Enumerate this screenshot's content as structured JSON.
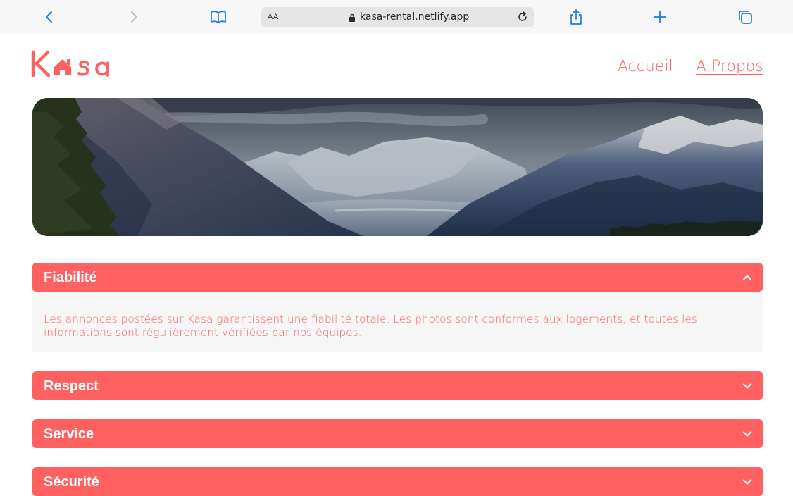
{
  "browser": {
    "reader_label": "AA",
    "url": "kasa-rental.netlify.app",
    "icons": [
      "back-icon",
      "forward-icon",
      "bookmarks-icon",
      "lock-icon",
      "reload-icon",
      "share-icon",
      "new-tab-icon",
      "tabs-icon"
    ]
  },
  "header": {
    "logo_text": "Kasa",
    "nav": [
      {
        "label": "Accueil"
      },
      {
        "label": "A Propos"
      }
    ]
  },
  "colors": {
    "accent": "#ff6060",
    "panel_bg": "#f6f6f6",
    "toolbar_bg": "#f7f7f7",
    "browser_blue": "#1f7ae0"
  },
  "collapses": [
    {
      "title": "Fiabilité",
      "expanded": true,
      "text": "Les annonces postées sur Kasa garantissent une fiabilité totale. Les photos sont conformes aux logements, et toutes les informations sont régulièrement vérifiées par nos équipes."
    },
    {
      "title": "Respect",
      "expanded": false
    },
    {
      "title": "Service",
      "expanded": false
    },
    {
      "title": "Sécurité",
      "expanded": false
    }
  ]
}
